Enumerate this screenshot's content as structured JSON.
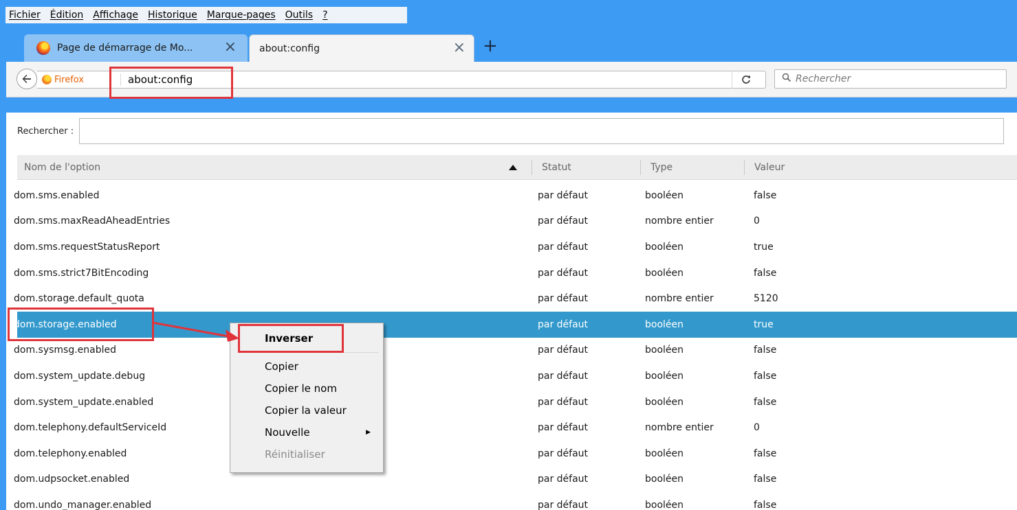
{
  "menubar": {
    "items": [
      "Fichier",
      "Édition",
      "Affichage",
      "Historique",
      "Marque-pages",
      "Outils",
      "?"
    ]
  },
  "tabs": [
    {
      "label": "Page de démarrage de Mo...",
      "active": false
    },
    {
      "label": "about:config",
      "active": true
    }
  ],
  "navbar": {
    "identity_label": "Firefox",
    "url": "about:config",
    "search_placeholder": "Rechercher"
  },
  "filter": {
    "label": "Rechercher :"
  },
  "columns": {
    "name": "Nom de l'option",
    "status": "Statut",
    "type": "Type",
    "value": "Valeur"
  },
  "rows": [
    {
      "name": "dom.sms.enabled",
      "status": "par défaut",
      "type": "booléen",
      "value": "false"
    },
    {
      "name": "dom.sms.maxReadAheadEntries",
      "status": "par défaut",
      "type": "nombre entier",
      "value": "0"
    },
    {
      "name": "dom.sms.requestStatusReport",
      "status": "par défaut",
      "type": "booléen",
      "value": "true"
    },
    {
      "name": "dom.sms.strict7BitEncoding",
      "status": "par défaut",
      "type": "booléen",
      "value": "false"
    },
    {
      "name": "dom.storage.default_quota",
      "status": "par défaut",
      "type": "nombre entier",
      "value": "5120"
    },
    {
      "name": "dom.storage.enabled",
      "status": "par défaut",
      "type": "booléen",
      "value": "true",
      "selected": true
    },
    {
      "name": "dom.sysmsg.enabled",
      "status": "par défaut",
      "type": "booléen",
      "value": "false"
    },
    {
      "name": "dom.system_update.debug",
      "status": "par défaut",
      "type": "booléen",
      "value": "false"
    },
    {
      "name": "dom.system_update.enabled",
      "status": "par défaut",
      "type": "booléen",
      "value": "false"
    },
    {
      "name": "dom.telephony.defaultServiceId",
      "status": "par défaut",
      "type": "nombre entier",
      "value": "0"
    },
    {
      "name": "dom.telephony.enabled",
      "status": "par défaut",
      "type": "booléen",
      "value": "false"
    },
    {
      "name": "dom.udpsocket.enabled",
      "status": "par défaut",
      "type": "booléen",
      "value": "false"
    },
    {
      "name": "dom.undo_manager.enabled",
      "status": "par défaut",
      "type": "booléen",
      "value": "false"
    }
  ],
  "context_menu": {
    "toggle": "Inverser",
    "copy": "Copier",
    "copy_name": "Copier le nom",
    "copy_value": "Copier la valeur",
    "new": "Nouvelle",
    "reset": "Réinitialiser"
  },
  "colors": {
    "frame": "#3d9bf4",
    "selection": "#3399cc",
    "highlight": "#e0343a"
  }
}
